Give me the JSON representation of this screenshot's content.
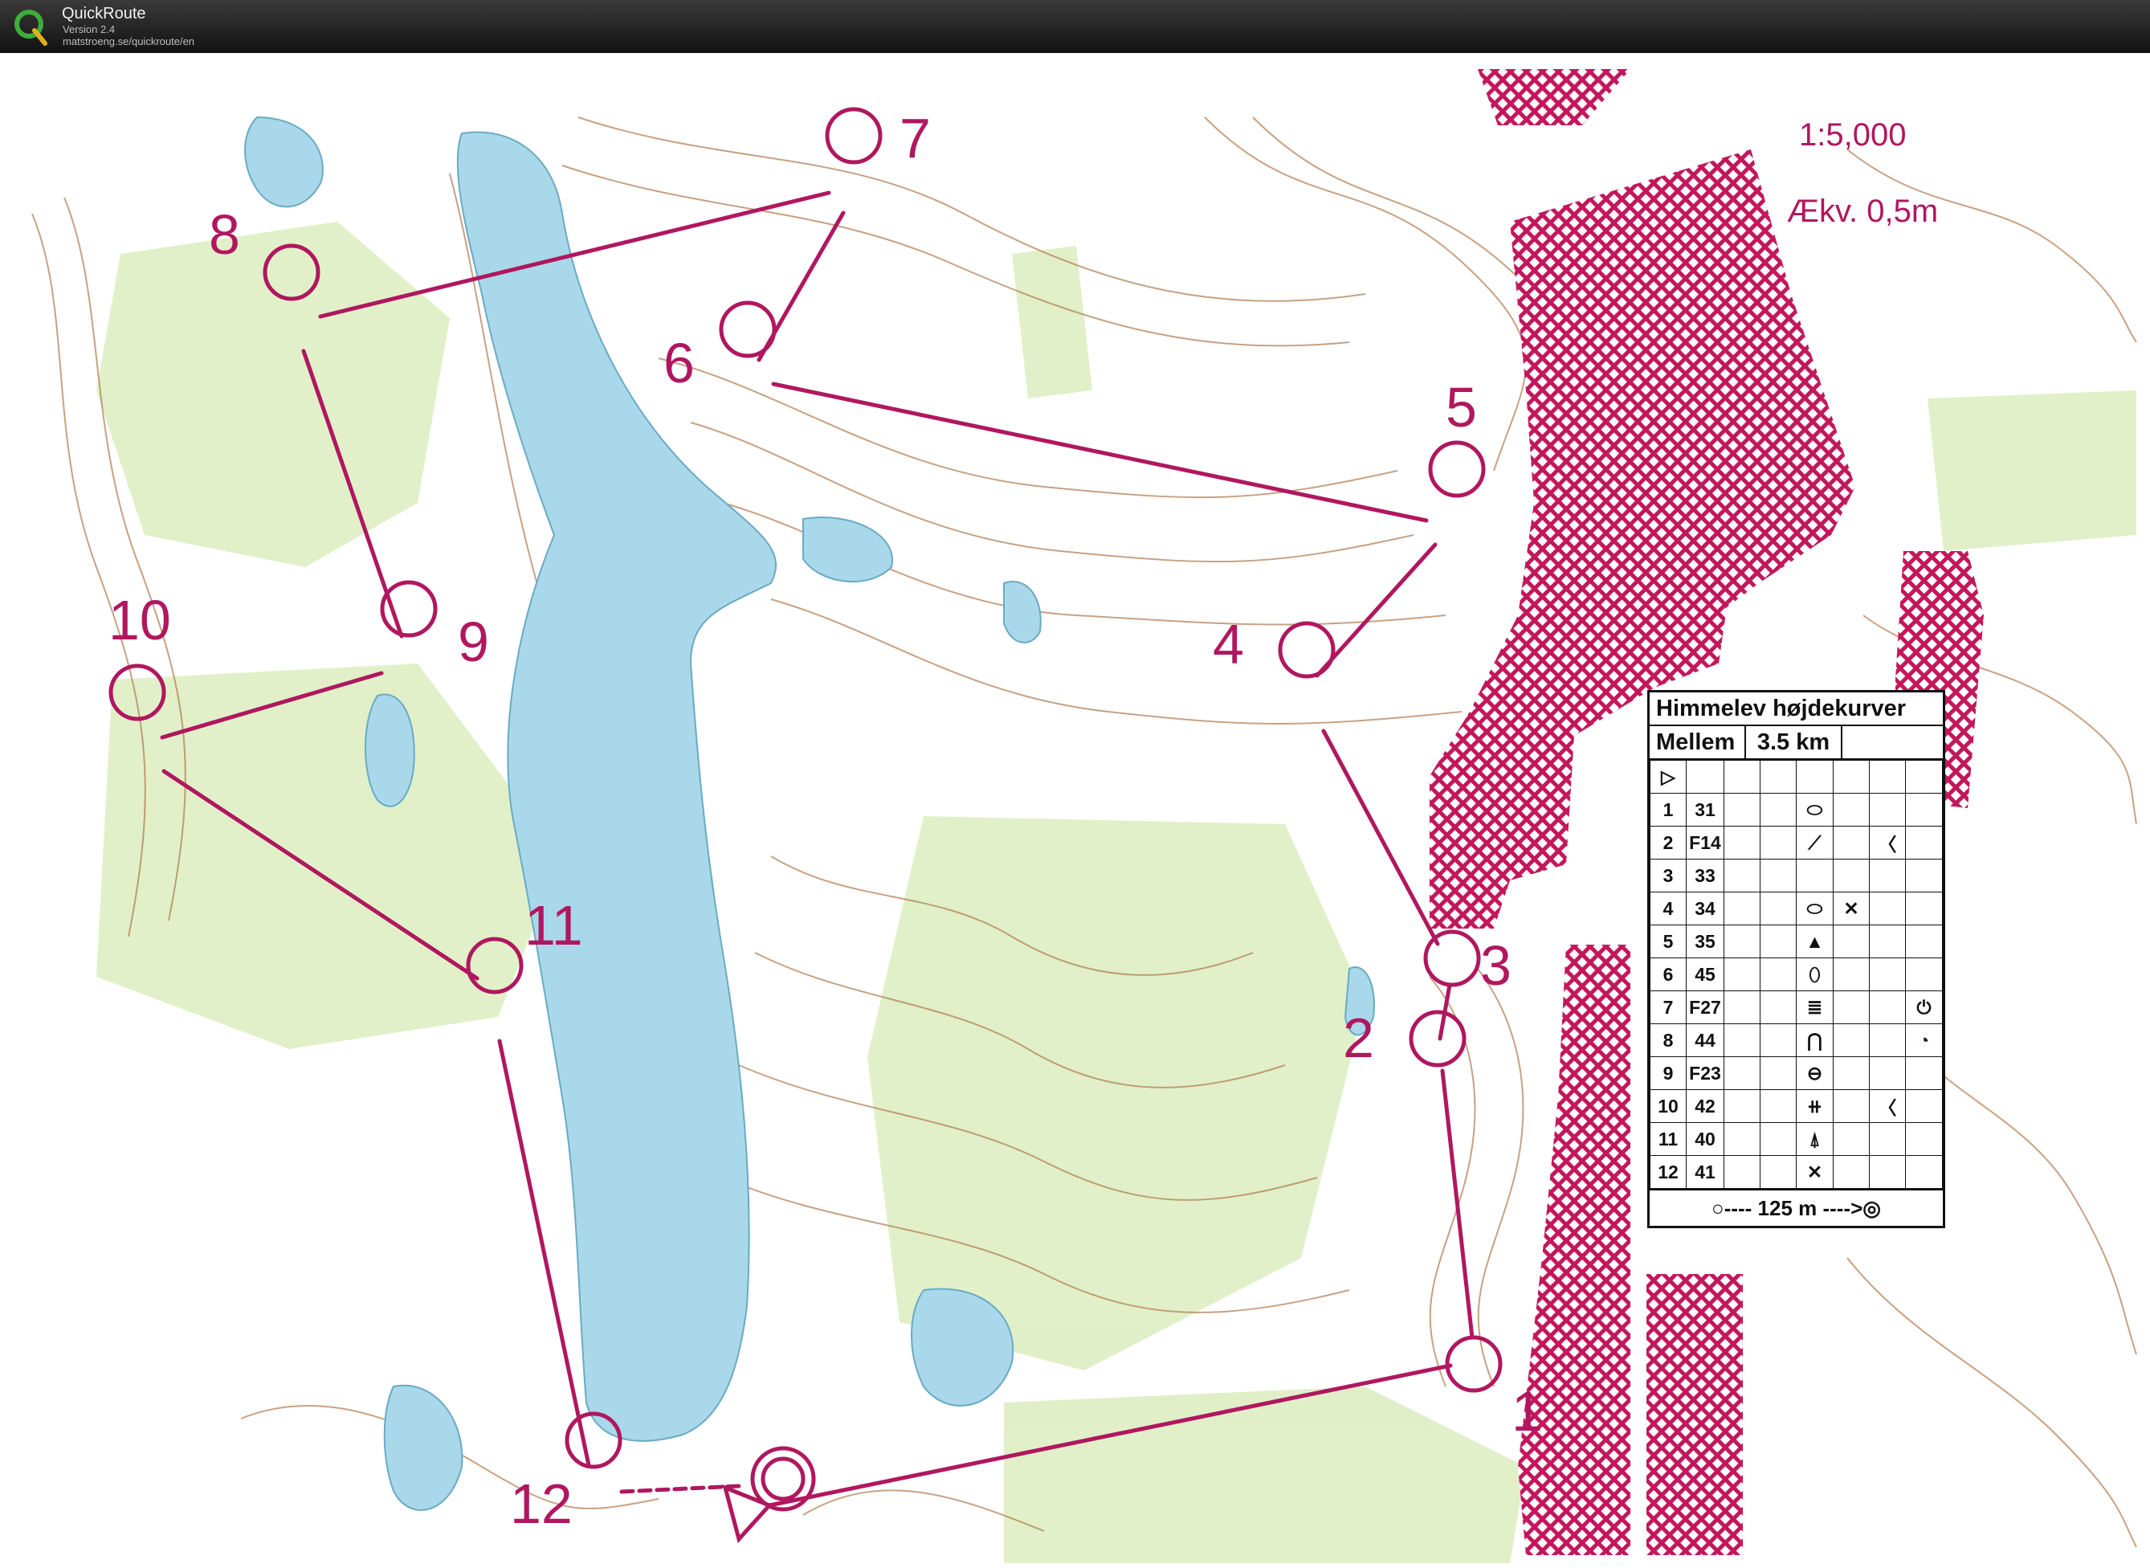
{
  "app": {
    "name": "QuickRoute",
    "version": "Version 2.4",
    "url": "matstroeng.se/quickroute/en"
  },
  "map": {
    "scale": "1:5,000",
    "contour_interval": "Ækv. 0,5m",
    "controls": [
      {
        "label": "1"
      },
      {
        "label": "2"
      },
      {
        "label": "3"
      },
      {
        "label": "4"
      },
      {
        "label": "5"
      },
      {
        "label": "6"
      },
      {
        "label": "7"
      },
      {
        "label": "8"
      },
      {
        "label": "9"
      },
      {
        "label": "10"
      },
      {
        "label": "11"
      },
      {
        "label": "12"
      }
    ],
    "course_color": "#b0175f",
    "water_color": "#a8d8ea",
    "vegetation_color": "#d9ecb9",
    "contour_color": "#b07a4e",
    "out_of_bounds_color": "#c2185b"
  },
  "description_sheet": {
    "title": "Himmelev højdekurver",
    "course": "Mellem",
    "length": "3.5 km",
    "start_symbol": "▷",
    "rows": [
      {
        "num": "1",
        "code": "31",
        "c": "",
        "d": "",
        "e": "⬭",
        "f": "",
        "g": "",
        "h": ""
      },
      {
        "num": "2",
        "code": "F14",
        "c": "",
        "d": "",
        "e": "⟋",
        "f": "",
        "g": "〈",
        "h": ""
      },
      {
        "num": "3",
        "code": "33",
        "c": "",
        "d": "",
        "e": "",
        "f": "",
        "g": "",
        "h": ""
      },
      {
        "num": "4",
        "code": "34",
        "c": "",
        "d": "",
        "e": "⬭",
        "f": "✕",
        "g": "",
        "h": ""
      },
      {
        "num": "5",
        "code": "35",
        "c": "",
        "d": "",
        "e": "▲",
        "f": "",
        "g": "",
        "h": ""
      },
      {
        "num": "6",
        "code": "45",
        "c": "",
        "d": "",
        "e": "⬯",
        "f": "",
        "g": "",
        "h": ""
      },
      {
        "num": "7",
        "code": "F27",
        "c": "",
        "d": "",
        "e": "≣",
        "f": "",
        "g": "",
        "h": "⏻"
      },
      {
        "num": "8",
        "code": "44",
        "c": "",
        "d": "",
        "e": "⋂",
        "f": "",
        "g": "",
        "h": "◔"
      },
      {
        "num": "9",
        "code": "F23",
        "c": "",
        "d": "",
        "e": "⊖",
        "f": "",
        "g": "",
        "h": ""
      },
      {
        "num": "10",
        "code": "42",
        "c": "",
        "d": "",
        "e": "⧺",
        "f": "",
        "g": "〈",
        "h": ""
      },
      {
        "num": "11",
        "code": "40",
        "c": "",
        "d": "",
        "e": "⍋",
        "f": "",
        "g": "",
        "h": ""
      },
      {
        "num": "12",
        "code": "41",
        "c": "",
        "d": "",
        "e": "✕",
        "f": "",
        "g": "",
        "h": ""
      }
    ],
    "footer": "○---- 125 m ---->◎"
  }
}
